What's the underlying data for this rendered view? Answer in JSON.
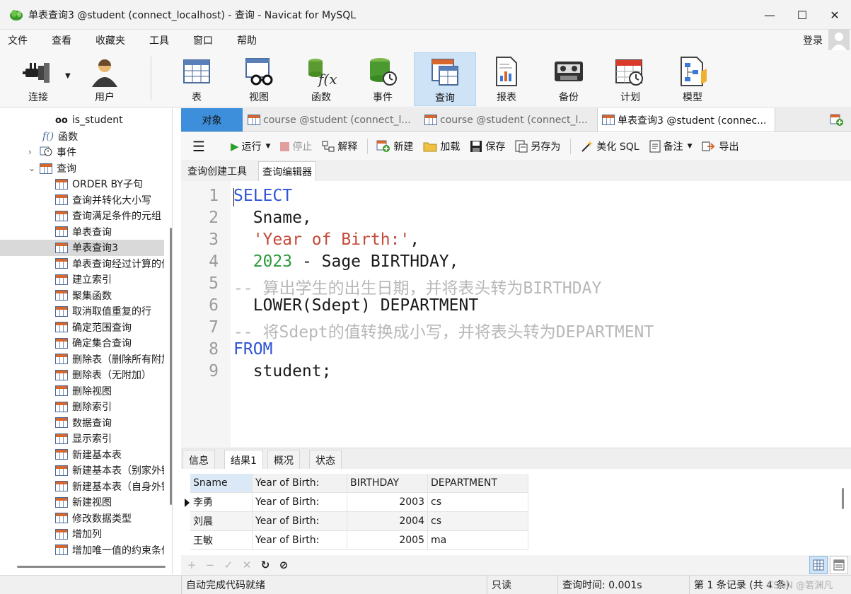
{
  "window": {
    "title": "单表查询3 @student (connect_localhost) - 查询 - Navicat for MySQL",
    "minimize": "—",
    "maximize": "☐",
    "close": "✕"
  },
  "menu": [
    "文件",
    "查看",
    "收藏夹",
    "工具",
    "窗口",
    "帮助"
  ],
  "login": "登录",
  "toolbar": {
    "connect": "连接",
    "user": "用户",
    "table": "表",
    "view": "视图",
    "function": "函数",
    "event": "事件",
    "query": "查询",
    "report": "报表",
    "backup": "备份",
    "schedule": "计划",
    "model": "模型"
  },
  "sidebar": {
    "top_items": [
      {
        "label": "is_student",
        "icon": "view-glasses-icon"
      },
      {
        "label": "函数",
        "icon": "function-icon"
      },
      {
        "label": "事件",
        "icon": "event-icon"
      },
      {
        "label": "查询",
        "icon": "query-icon"
      }
    ],
    "queries": [
      "ORDER BY子句",
      "查询并转化大小写",
      "查询满足条件的元组",
      "单表查询",
      "单表查询3",
      "单表查询经过计算的值",
      "建立索引",
      "聚集函数",
      "取消取值重复的行",
      "确定范围查询",
      "确定集合查询",
      "删除表（删除所有附加）",
      "删除表（无附加）",
      "删除视图",
      "删除索引",
      "数据查询",
      "显示索引",
      "新建基本表",
      "新建基本表（别家外键）",
      "新建基本表（自身外键）",
      "新建视图",
      "修改数据类型",
      "增加列",
      "增加唯一值的约束条件"
    ],
    "selected": "单表查询3"
  },
  "tabs": {
    "objects": "对象",
    "tab1": "course @student (connect_l...",
    "tab2": "course @student (connect_l...",
    "tab3": "单表查询3 @student (connec..."
  },
  "query_toolbar": {
    "run": "运行",
    "stop": "停止",
    "explain": "解释",
    "new": "新建",
    "load": "加载",
    "save": "保存",
    "save_as": "另存为",
    "beautify": "美化 SQL",
    "comment": "备注",
    "export": "导出"
  },
  "sub_tabs": {
    "builder": "查询创建工具",
    "editor": "查询编辑器"
  },
  "editor": {
    "lines": [
      {
        "n": "1",
        "parts": [
          {
            "t": "SELECT",
            "c": "kw"
          }
        ]
      },
      {
        "n": "2",
        "parts": [
          {
            "t": "  Sname,",
            "c": ""
          }
        ]
      },
      {
        "n": "3",
        "parts": [
          {
            "t": "  ",
            "c": ""
          },
          {
            "t": "'Year of Birth:'",
            "c": "str"
          },
          {
            "t": ",",
            "c": ""
          }
        ]
      },
      {
        "n": "4",
        "parts": [
          {
            "t": "  ",
            "c": ""
          },
          {
            "t": "2023",
            "c": "num"
          },
          {
            "t": " - Sage BIRTHDAY,",
            "c": ""
          }
        ]
      },
      {
        "n": "5",
        "parts": [
          {
            "t": "-- 算出学生的出生日期，并将表头转为BIRTHDAY",
            "c": "cmt"
          }
        ]
      },
      {
        "n": "6",
        "parts": [
          {
            "t": "  LOWER(Sdept) DEPARTMENT",
            "c": ""
          }
        ]
      },
      {
        "n": "7",
        "parts": [
          {
            "t": "-- 将Sdept的值转换成小写，并将表头转为DEPARTMENT",
            "c": "cmt"
          }
        ]
      },
      {
        "n": "8",
        "parts": [
          {
            "t": "FROM",
            "c": "kw"
          }
        ]
      },
      {
        "n": "9",
        "parts": [
          {
            "t": "  student;",
            "c": ""
          }
        ]
      }
    ]
  },
  "result_tabs": [
    "信息",
    "结果1",
    "概况",
    "状态"
  ],
  "result_grid": {
    "columns": [
      "Sname",
      "Year of Birth:",
      "BIRTHDAY",
      "DEPARTMENT"
    ],
    "rows": [
      [
        "李勇",
        "Year of Birth:",
        "2003",
        "cs"
      ],
      [
        "刘晨",
        "Year of Birth:",
        "2004",
        "cs"
      ],
      [
        "王敏",
        "Year of Birth:",
        "2005",
        "ma"
      ]
    ]
  },
  "grid_footer": {
    "add": "+",
    "delete": "−",
    "apply": "✓",
    "discard": "✕",
    "refresh": "↻",
    "stop": "⊘"
  },
  "status": {
    "message": "自动完成代码就绪",
    "readonly": "只读",
    "query_time": "查询时间: 0.001s",
    "records": "第 1 条记录 (共 4 条)",
    "watermark": "CSDN @箬渊凡"
  },
  "colors": {
    "accent_blue": "#3d8fdc",
    "keyword": "#2f54d6",
    "string": "#c44a3a",
    "number": "#2a9a3a",
    "comment": "#b8b8b8"
  }
}
